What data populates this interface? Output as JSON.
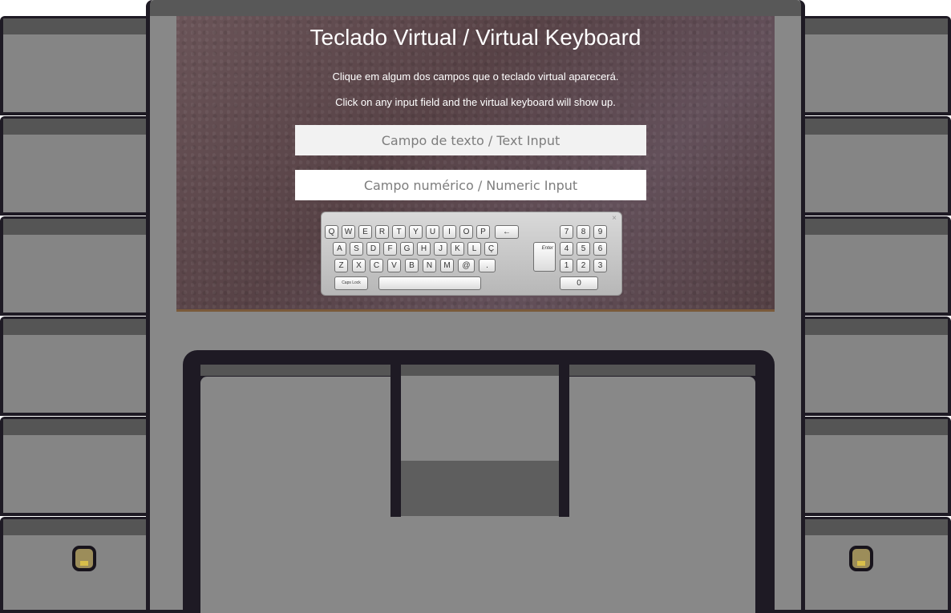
{
  "screen": {
    "title": "Teclado Virtual / Virtual Keyboard",
    "subtitle_pt": "Clique em algum dos campos que o teclado virtual aparecerá.",
    "subtitle_en": "Click on any input field and the virtual keyboard will show up.",
    "text_input": {
      "placeholder": "Campo de texto / Text Input",
      "value": ""
    },
    "numeric_input": {
      "placeholder": "Campo numérico / Numeric Input",
      "value": ""
    }
  },
  "keyboard": {
    "close": "×",
    "row1": [
      "Q",
      "W",
      "E",
      "R",
      "T",
      "Y",
      "U",
      "I",
      "O",
      "P"
    ],
    "row2": [
      "A",
      "S",
      "D",
      "F",
      "G",
      "H",
      "J",
      "K",
      "L",
      "Ç"
    ],
    "row3": [
      "Z",
      "X",
      "C",
      "V",
      "B",
      "N",
      "M",
      "@",
      "."
    ],
    "backspace": "←",
    "enter": "Enter",
    "capslock": "Caps Lock",
    "space": "",
    "numpad": [
      "7",
      "8",
      "9",
      "4",
      "5",
      "6",
      "1",
      "2",
      "3",
      "0"
    ]
  },
  "colors": {
    "outline": "#1e1a24",
    "panel": "#888888",
    "panel_dark": "#555555",
    "knob": "#9c8d5a"
  },
  "icons": {
    "knob_left": "cabinet-knob-icon",
    "knob_right": "cabinet-knob-icon",
    "backspace": "backspace-arrow-icon",
    "close": "close-icon"
  }
}
